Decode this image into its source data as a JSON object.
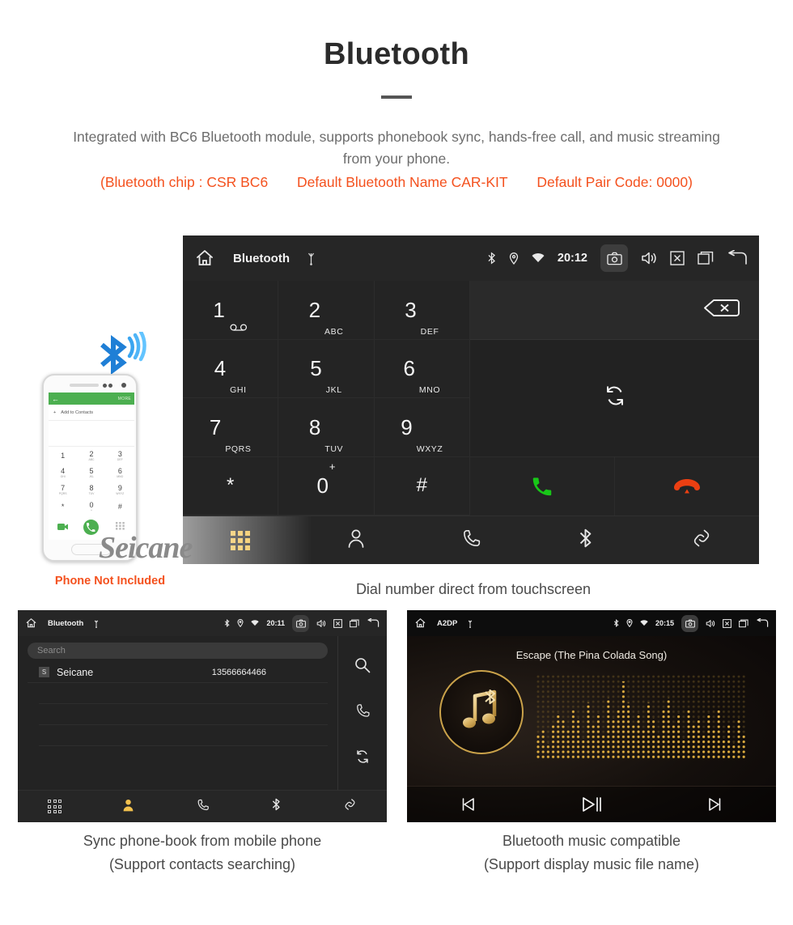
{
  "header": {
    "title": "Bluetooth",
    "subtitle": "Integrated with BC6 Bluetooth module, supports phonebook sync, hands-free call, and music streaming from your phone.",
    "spec_chip": "(Bluetooth chip : CSR BC6",
    "spec_name": "Default Bluetooth Name CAR-KIT",
    "spec_pair": "Default Pair Code: 0000)",
    "accent_color": "#f4511e",
    "rule_color": "#555555"
  },
  "watermark": {
    "text": "Seicane"
  },
  "phone_illustration": {
    "note": "Phone Not Included",
    "app_more_label": "MORE",
    "add_contact_label": "Add to Contacts",
    "keys": [
      {
        "num": "1",
        "sub": "∞"
      },
      {
        "num": "2",
        "sub": "ABC"
      },
      {
        "num": "3",
        "sub": "DEF"
      },
      {
        "num": "4",
        "sub": "GHI"
      },
      {
        "num": "5",
        "sub": "JKL"
      },
      {
        "num": "6",
        "sub": "MNO"
      },
      {
        "num": "7",
        "sub": "PQRS"
      },
      {
        "num": "8",
        "sub": "TUV"
      },
      {
        "num": "9",
        "sub": "WXYZ"
      },
      {
        "num": "*",
        "sub": ""
      },
      {
        "num": "0",
        "sub": "+"
      },
      {
        "num": "#",
        "sub": ""
      }
    ]
  },
  "dialer_screen": {
    "statusbar": {
      "title": "Bluetooth",
      "time": "20:12",
      "icons_left": [
        "home-icon",
        "usb-icon"
      ],
      "icons_right": [
        "bluetooth-icon",
        "location-icon",
        "wifi-icon",
        "camera-icon",
        "volume-icon",
        "close-box-icon",
        "recents-icon",
        "back-icon"
      ]
    },
    "keys": [
      {
        "num": "1",
        "sub": "voicemail"
      },
      {
        "num": "2",
        "sub": "ABC"
      },
      {
        "num": "3",
        "sub": "DEF"
      },
      {
        "num": "4",
        "sub": "GHI"
      },
      {
        "num": "5",
        "sub": "JKL"
      },
      {
        "num": "6",
        "sub": "MNO"
      },
      {
        "num": "7",
        "sub": "PQRS"
      },
      {
        "num": "8",
        "sub": "TUV"
      },
      {
        "num": "9",
        "sub": "WXYZ"
      },
      {
        "num": "*",
        "sub": ""
      },
      {
        "num": "0",
        "sub": "+"
      },
      {
        "num": "#",
        "sub": ""
      }
    ],
    "number_input_value": "",
    "actions": {
      "backspace": "backspace-icon",
      "transfer": "transfer-audio-icon",
      "call": "call-button",
      "hangup": "hangup-button",
      "call_color": "#18c718",
      "hangup_color": "#ec3f12"
    },
    "tabs": [
      {
        "name": "dialpad",
        "active": true
      },
      {
        "name": "contacts",
        "active": false
      },
      {
        "name": "call-history",
        "active": false
      },
      {
        "name": "bluetooth",
        "active": false
      },
      {
        "name": "link",
        "active": false
      }
    ],
    "active_tab_color": "#f2c14e",
    "caption": "Dial number direct from touchscreen"
  },
  "contacts_screen": {
    "statusbar": {
      "title": "Bluetooth",
      "time": "20:11"
    },
    "search_placeholder": "Search",
    "contacts": [
      {
        "initial": "S",
        "name": "Seicane",
        "number": "13566664466"
      }
    ],
    "side_actions": [
      "search-icon",
      "call-icon",
      "sync-icon"
    ],
    "tabs": [
      {
        "name": "dialpad",
        "active": false
      },
      {
        "name": "contacts",
        "active": true
      },
      {
        "name": "call-history",
        "active": false
      },
      {
        "name": "bluetooth",
        "active": false
      },
      {
        "name": "link",
        "active": false
      }
    ],
    "caption_line1": "Sync phone-book from mobile phone",
    "caption_line2": "(Support contacts searching)"
  },
  "music_screen": {
    "statusbar": {
      "title": "A2DP",
      "time": "20:15"
    },
    "song_title": "Escape (The Pina Colada Song)",
    "controls": [
      "previous-track-button",
      "play-pause-button",
      "next-track-button"
    ],
    "accent_color": "#caa24a",
    "caption_line1": "Bluetooth music compatible",
    "caption_line2": "(Support display music file name)"
  }
}
